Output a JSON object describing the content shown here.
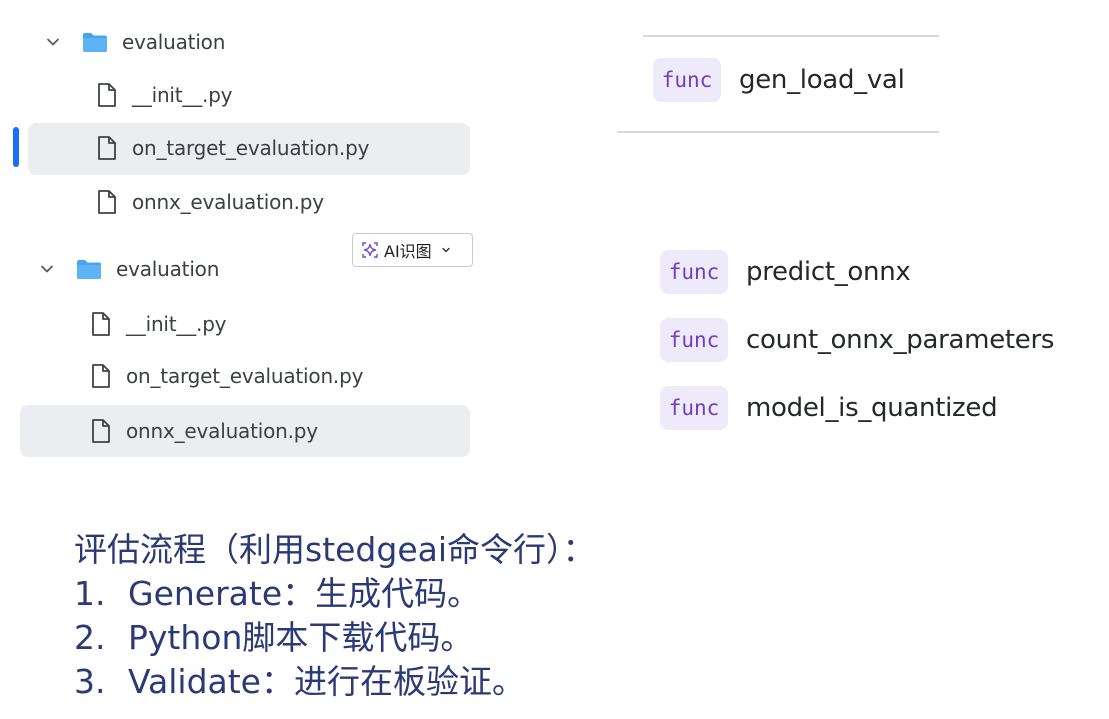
{
  "tree_top": {
    "folder": "evaluation",
    "files": [
      "__init__.py",
      "on_target_evaluation.py",
      "onnx_evaluation.py"
    ]
  },
  "tree_bottom": {
    "folder": "evaluation",
    "files": [
      "__init__.py",
      "on_target_evaluation.py",
      "onnx_evaluation.py"
    ]
  },
  "ai_chip": {
    "label": "AI识图",
    "icon": "sparkle-icon"
  },
  "functions_top": [
    {
      "tag": "func",
      "name": "gen_load_val"
    }
  ],
  "functions_bottom": [
    {
      "tag": "func",
      "name": "predict_onnx"
    },
    {
      "tag": "func",
      "name": "count_onnx_parameters"
    },
    {
      "tag": "func",
      "name": "model_is_quantized"
    }
  ],
  "notes": {
    "heading": "评估流程（利用stedgeai命令行）：",
    "steps": [
      {
        "num": "1.",
        "text": "Generate：生成代码。"
      },
      {
        "num": "2.",
        "text": "Python脚本下载代码。"
      },
      {
        "num": "3.",
        "text": "Validate：进行在板验证。"
      }
    ]
  },
  "colors": {
    "accent": "#1a6dff",
    "folder": "#4aa3ef",
    "func_tag_bg": "#efeaf9",
    "func_tag_text": "#6e3fc2",
    "notes_text": "#2b3a77",
    "selected_bg": "#ebedf0"
  }
}
